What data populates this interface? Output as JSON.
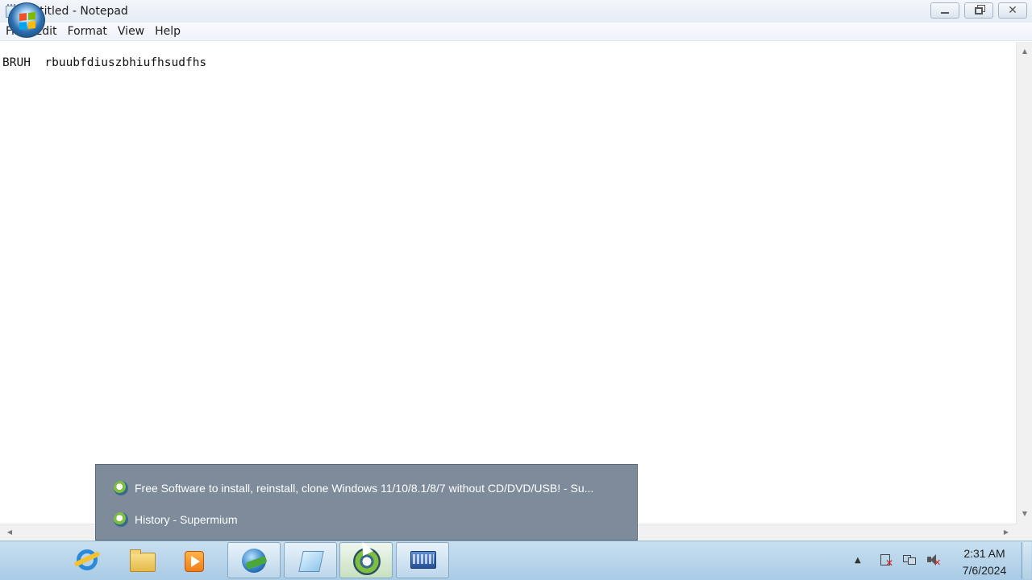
{
  "window": {
    "title": "Untitled - Notepad"
  },
  "menu": [
    "File",
    "Edit",
    "Format",
    "View",
    "Help"
  ],
  "editor": {
    "content": "BRUH  rbuubfdiuszbhiufhsudfhs"
  },
  "jumplist": {
    "items": [
      "Free Software to install, reinstall, clone Windows 11/10/8.1/8/7 without CD/DVD/USB! - Su...",
      "History - Supermium"
    ]
  },
  "taskbar": {
    "apps": [
      "internet-explorer-icon",
      "file-explorer-icon",
      "media-player-icon",
      "idm-icon",
      "notepad-icon",
      "supermium-icon",
      "keyboard-app-icon"
    ]
  },
  "clock": {
    "time": "2:31 AM",
    "date": "7/6/2024"
  }
}
